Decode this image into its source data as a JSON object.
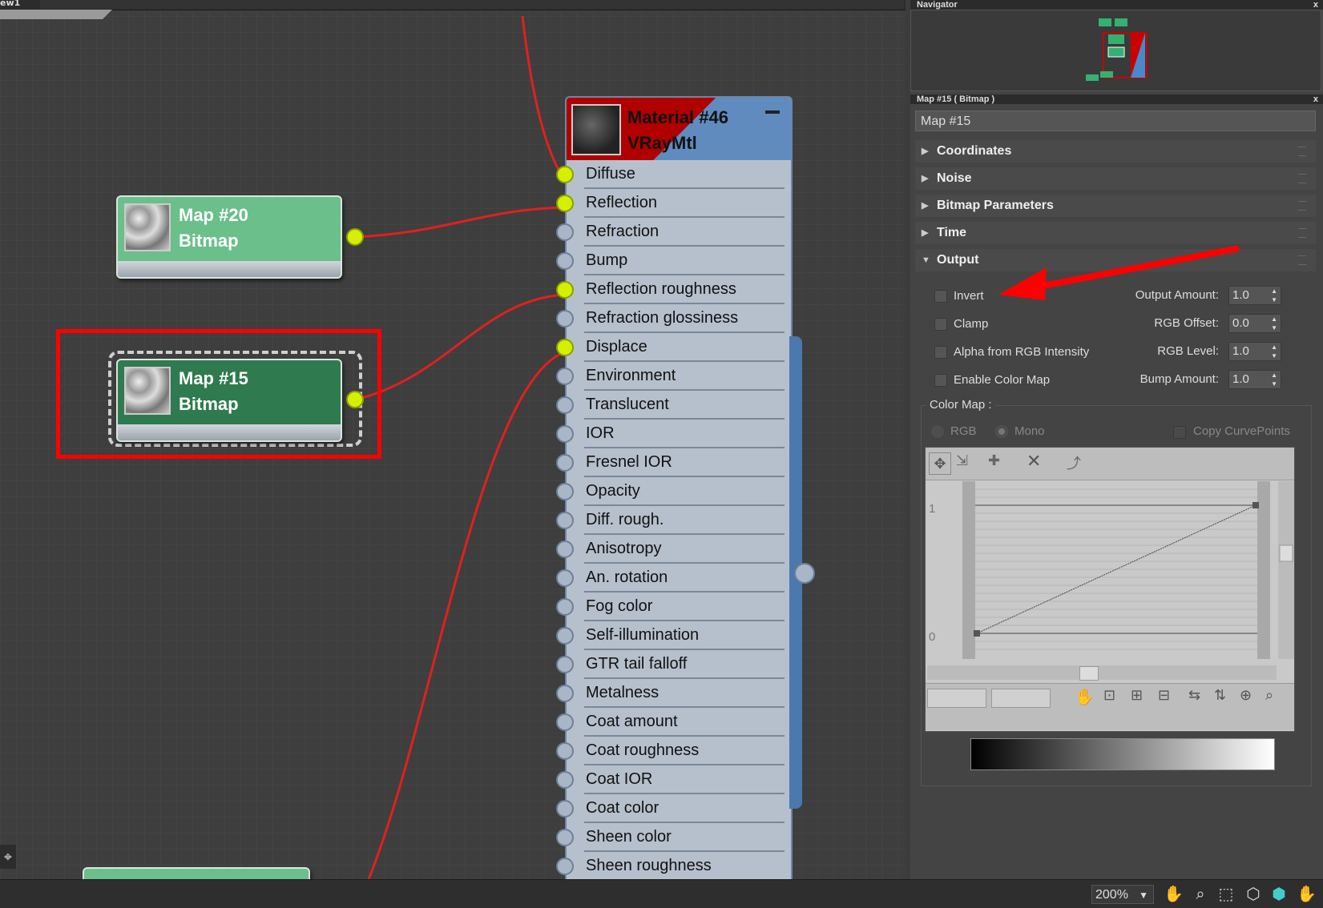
{
  "graph": {
    "view_tab_label": "ew1"
  },
  "nodes": {
    "map20": {
      "title": "Map #20",
      "type": "Bitmap"
    },
    "map15": {
      "title": "Map #15",
      "type": "Bitmap"
    },
    "material": {
      "title": "Material #46",
      "type": "VRayMtl",
      "slots": [
        {
          "label": "Diffuse",
          "connected": true
        },
        {
          "label": "Reflection",
          "connected": true
        },
        {
          "label": "Refraction",
          "connected": false
        },
        {
          "label": "Bump",
          "connected": false
        },
        {
          "label": "Reflection roughness",
          "connected": true
        },
        {
          "label": "Refraction glossiness",
          "connected": false
        },
        {
          "label": "Displace",
          "connected": true
        },
        {
          "label": "Environment",
          "connected": false
        },
        {
          "label": "Translucent",
          "connected": false
        },
        {
          "label": "IOR",
          "connected": false
        },
        {
          "label": "Fresnel IOR",
          "connected": false
        },
        {
          "label": "Opacity",
          "connected": false
        },
        {
          "label": "Diff. rough.",
          "connected": false
        },
        {
          "label": "Anisotropy",
          "connected": false
        },
        {
          "label": "An. rotation",
          "connected": false
        },
        {
          "label": "Fog color",
          "connected": false
        },
        {
          "label": "Self-illumination",
          "connected": false
        },
        {
          "label": "GTR tail falloff",
          "connected": false
        },
        {
          "label": "Metalness",
          "connected": false
        },
        {
          "label": "Coat amount",
          "connected": false
        },
        {
          "label": "Coat roughness",
          "connected": false
        },
        {
          "label": "Coat IOR",
          "connected": false
        },
        {
          "label": "Coat color",
          "connected": false
        },
        {
          "label": "Sheen color",
          "connected": false
        },
        {
          "label": "Sheen roughness",
          "connected": false
        }
      ]
    }
  },
  "navigator": {
    "title": "Navigator",
    "close": "x"
  },
  "params": {
    "title": "Map #15  ( Bitmap )",
    "close": "x",
    "map_name": "Map #15",
    "rollouts": [
      "Coordinates",
      "Noise",
      "Bitmap Parameters",
      "Time",
      "Output"
    ],
    "output": {
      "checkboxes": [
        "Invert",
        "Clamp",
        "Alpha from RGB Intensity",
        "Enable Color Map"
      ],
      "spinners": [
        {
          "label": "Output Amount:",
          "value": "1.0"
        },
        {
          "label": "RGB Offset:",
          "value": "0.0"
        },
        {
          "label": "RGB Level:",
          "value": "1.0"
        },
        {
          "label": "Bump Amount:",
          "value": "1.0"
        }
      ],
      "color_map_label": "Color Map :",
      "radio_rgb": "RGB",
      "radio_mono": "Mono",
      "copy_curve": "Copy CurvePoints",
      "curve_y_top": "1",
      "curve_y_bottom": "0"
    }
  },
  "status": {
    "zoom": "200%"
  },
  "colors": {
    "accent_red": "#ff0000",
    "socket_yellow": "#d4f000",
    "map_green": "#6bbf8a",
    "map_selected_green": "#2f7a4f",
    "material_blue": "#5f8bbf"
  }
}
